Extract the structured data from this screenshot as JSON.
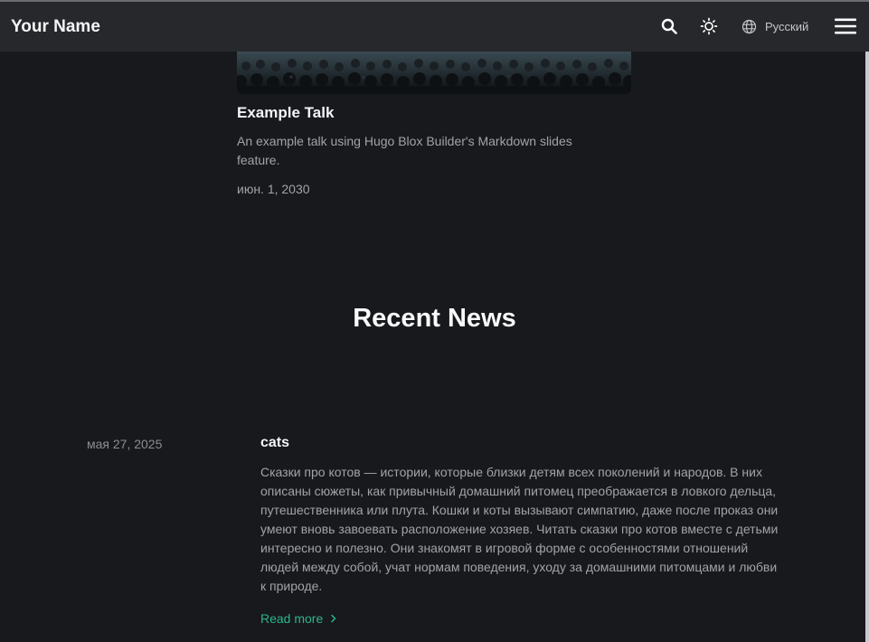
{
  "navbar": {
    "brand": "Your Name",
    "language": "Русский",
    "icons": {
      "search": "search-icon",
      "theme": "sun-icon",
      "language": "globe-icon",
      "menu": "hamburger-menu-icon"
    }
  },
  "talk": {
    "title": "Example Talk",
    "summary": "An example talk using Hugo Blox Builder's Markdown slides feature.",
    "date": "июн. 1, 2030"
  },
  "news": {
    "section_title": "Recent News",
    "items": [
      {
        "date": "мая 27, 2025",
        "title": "cats",
        "summary": "Сказки про котов — истории, которые близки детям всех поколений и народов. В них описаны сюжеты, как привычный домашний питомец преображается в ловкого дельца, путешественника или плута. Кошки и коты вызывают симпатию, даже после проказ они умеют вновь завоевать расположение хозяев. Читать сказки про котов вместе с детьми интересно и полезно. Они знакомят в игровой форме с особенностями отношений людей между собой, учат нормам поведения, уходу за домашними питомцами и любви к природе.",
        "read_more": "Read more"
      }
    ]
  },
  "colors": {
    "background": "#18191d",
    "navbar": "#27282c",
    "accent": "#2bb58a"
  }
}
